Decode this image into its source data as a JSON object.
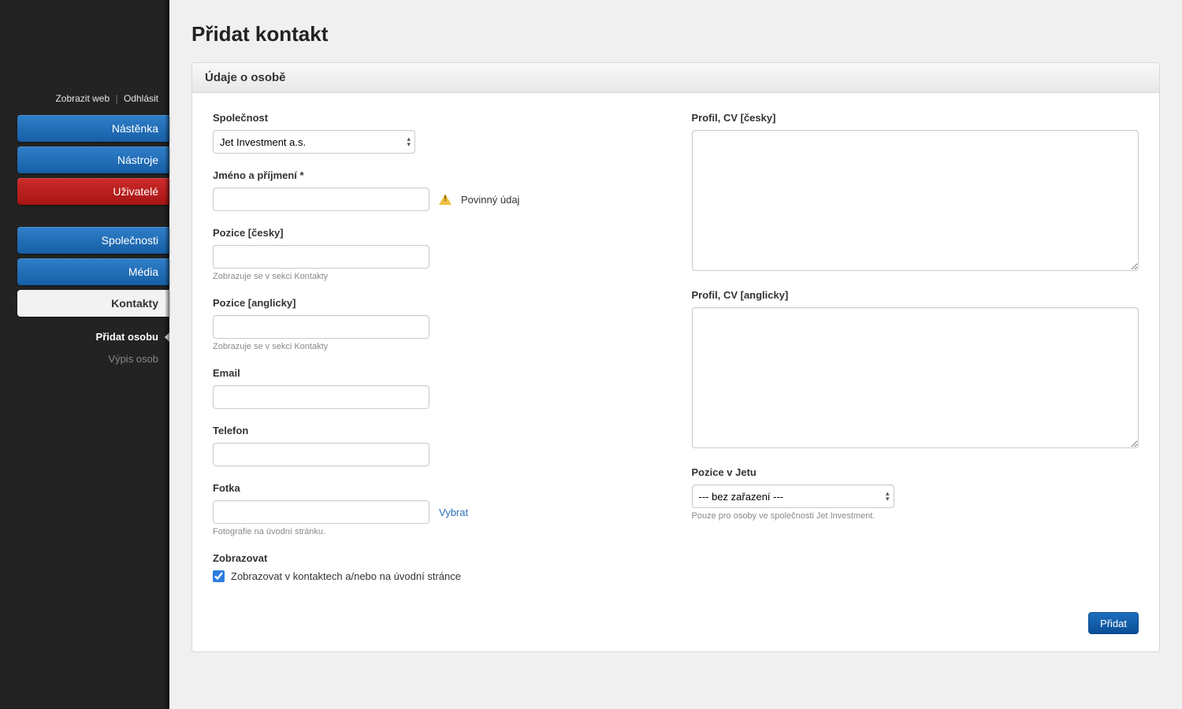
{
  "sidebar": {
    "links": {
      "view_web": "Zobrazit web",
      "logout": "Odhlásit"
    },
    "group1": [
      {
        "label": "Nástěnka",
        "style": "blue"
      },
      {
        "label": "Nástroje",
        "style": "blue"
      },
      {
        "label": "Uživatelé",
        "style": "red"
      }
    ],
    "group2": [
      {
        "label": "Společnosti",
        "style": "blue"
      },
      {
        "label": "Média",
        "style": "blue"
      },
      {
        "label": "Kontakty",
        "style": "active"
      }
    ],
    "subnav": [
      {
        "label": "Přidat osobu",
        "current": true
      },
      {
        "label": "Výpis osob",
        "current": false
      }
    ]
  },
  "page_title": "Přidat kontakt",
  "panel_title": "Údaje o osobě",
  "left": {
    "company": {
      "label": "Společnost",
      "value": "Jet Investment a.s."
    },
    "name": {
      "label": "Jméno a příjmení *",
      "value": "",
      "warn": "Povinný údaj"
    },
    "pos_cs": {
      "label": "Pozice [česky]",
      "value": "",
      "help": "Zobrazuje se v sekci Kontakty"
    },
    "pos_en": {
      "label": "Pozice [anglicky]",
      "value": "",
      "help": "Zobrazuje se v sekci Kontakty"
    },
    "email": {
      "label": "Email",
      "value": ""
    },
    "phone": {
      "label": "Telefon",
      "value": ""
    },
    "photo": {
      "label": "Fotka",
      "value": "",
      "choose": "Vybrat",
      "help": "Fotografie na úvodní stránku."
    },
    "show": {
      "label": "Zobrazovat",
      "checkbox_label": "Zobrazovat v kontaktech a/nebo na úvodní stránce",
      "checked": true
    }
  },
  "right": {
    "profile_cs": {
      "label": "Profil, CV [česky]",
      "value": ""
    },
    "profile_en": {
      "label": "Profil, CV [anglicky]",
      "value": ""
    },
    "jet_pos": {
      "label": "Pozice v Jetu",
      "value": "--- bez zařazení ---",
      "help": "Pouze pro osoby ve společnosti Jet Investment."
    }
  },
  "submit_label": "Přidat"
}
